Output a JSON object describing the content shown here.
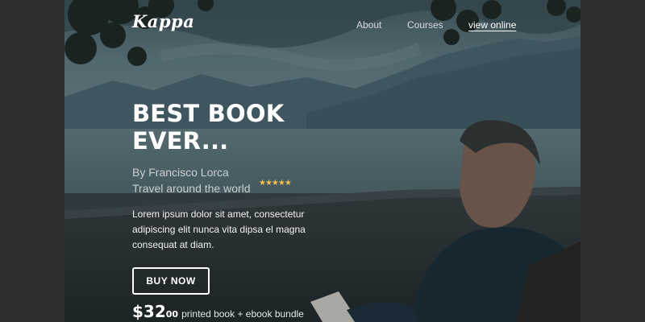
{
  "header": {
    "logo": "Kappa",
    "nav": [
      {
        "label": "About"
      },
      {
        "label": "Courses"
      },
      {
        "label": "view online"
      }
    ]
  },
  "hero": {
    "title_line1": "BEST BOOK",
    "title_line2": "EVER...",
    "author": "By Francisco Lorca",
    "subtitle": "Travel around the world",
    "rating_stars": 5,
    "rating_display": "★★★★★",
    "description": "Lorem ipsum dolor sit amet, consectetur adipiscing elit nunca vita dipsa el magna consequat at diam.",
    "cta_label": "BUY NOW",
    "price_main": "$32",
    "price_cents": "00",
    "price_note": "printed book + ebook bundle"
  },
  "colors": {
    "page_background": "#2f2f31",
    "text": "#ffffff",
    "muted_text": "#c9cfd2",
    "stars": "#f2c14e"
  }
}
